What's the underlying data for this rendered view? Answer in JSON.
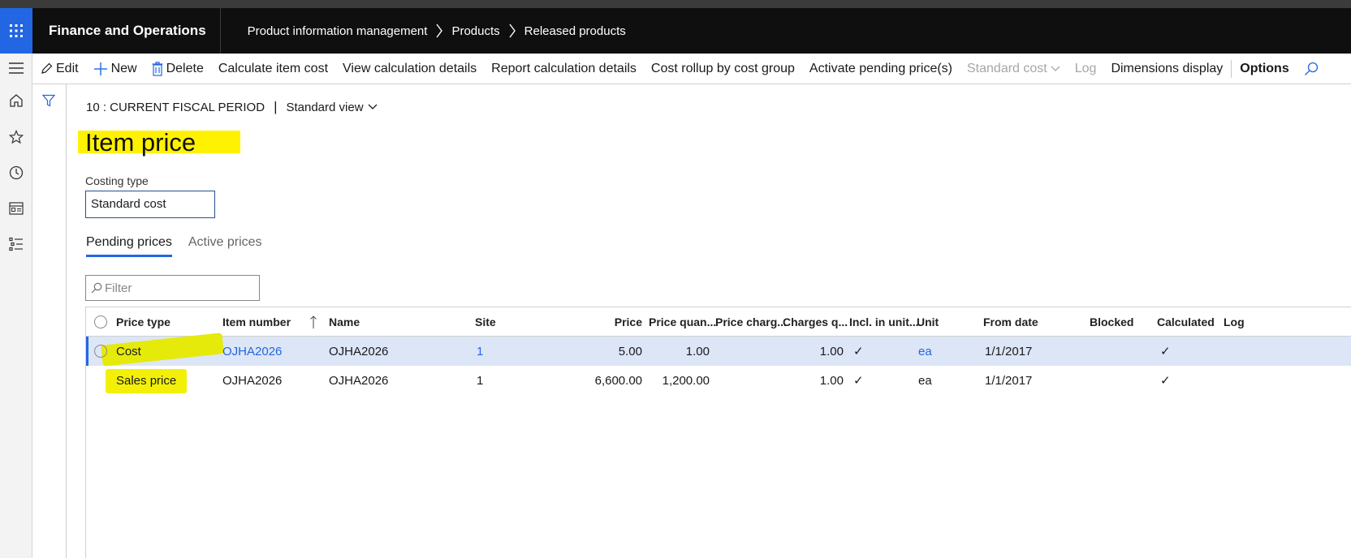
{
  "app": {
    "title": "Finance and Operations",
    "breadcrumbs": [
      "Product information management",
      "Products",
      "Released products"
    ]
  },
  "actionbar": {
    "edit": "Edit",
    "new": "New",
    "delete": "Delete",
    "calculate_item_cost": "Calculate item cost",
    "view_calc_details": "View calculation details",
    "report_calc_details": "Report calculation details",
    "cost_rollup": "Cost rollup by cost group",
    "activate_pending": "Activate pending price(s)",
    "standard_cost": "Standard cost",
    "log": "Log",
    "dimensions_display": "Dimensions display",
    "options": "Options"
  },
  "page": {
    "fiscal_period": "10 : CURRENT FISCAL PERIOD",
    "separator": "|",
    "view_name": "Standard view",
    "title": "Item price",
    "costing_type_label": "Costing type",
    "costing_type_value": "Standard cost",
    "tabs": [
      "Pending prices",
      "Active prices"
    ],
    "filter_placeholder": "Filter"
  },
  "grid": {
    "columns": [
      "Price type",
      "Item number",
      "Name",
      "Site",
      "Price",
      "Price quan...",
      "Price charg...",
      "Charges q...",
      "Incl. in unit...",
      "Unit",
      "From date",
      "Blocked",
      "Calculated",
      "Log"
    ],
    "rows": [
      {
        "price_type": "Cost",
        "item_number": "OJHA2026",
        "name": "OJHA2026",
        "site": "1",
        "price": "5.00",
        "price_qty": "1.00",
        "price_charges": "",
        "charges_qty": "1.00",
        "incl_unit": "✓",
        "unit": "ea",
        "from_date": "1/1/2017",
        "blocked": "",
        "calculated": "✓",
        "log": ""
      },
      {
        "price_type": "Sales price",
        "item_number": "OJHA2026",
        "name": "OJHA2026",
        "site": "1",
        "price": "6,600.00",
        "price_qty": "1,200.00",
        "price_charges": "",
        "charges_qty": "1.00",
        "incl_unit": "✓",
        "unit": "ea",
        "from_date": "1/1/2017",
        "blocked": "",
        "calculated": "✓",
        "log": ""
      }
    ]
  },
  "colors": {
    "accent": "#2266e3",
    "topbar": "#0f0f0f",
    "selected_row": "#dce6f7",
    "highlight": "#fff200"
  }
}
